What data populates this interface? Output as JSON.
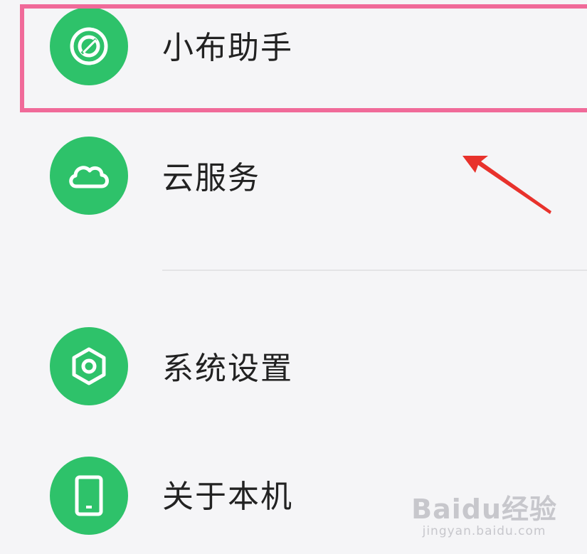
{
  "menu": {
    "items": [
      {
        "label": "小布助手",
        "icon": "xiaobu-assistant-icon"
      },
      {
        "label": "云服务",
        "icon": "cloud-icon"
      },
      {
        "label": "系统设置",
        "icon": "hexagon-settings-icon"
      },
      {
        "label": "关于本机",
        "icon": "phone-icon"
      }
    ]
  },
  "annotation": {
    "highlight_color": "#f06a99",
    "arrow_color": "#e8322c"
  },
  "watermark": {
    "main": "Baidu经验",
    "sub": "jingyan.baidu.com"
  },
  "colors": {
    "icon_bg": "#2ec26a",
    "background": "#f5f5f7",
    "text": "#222222"
  }
}
